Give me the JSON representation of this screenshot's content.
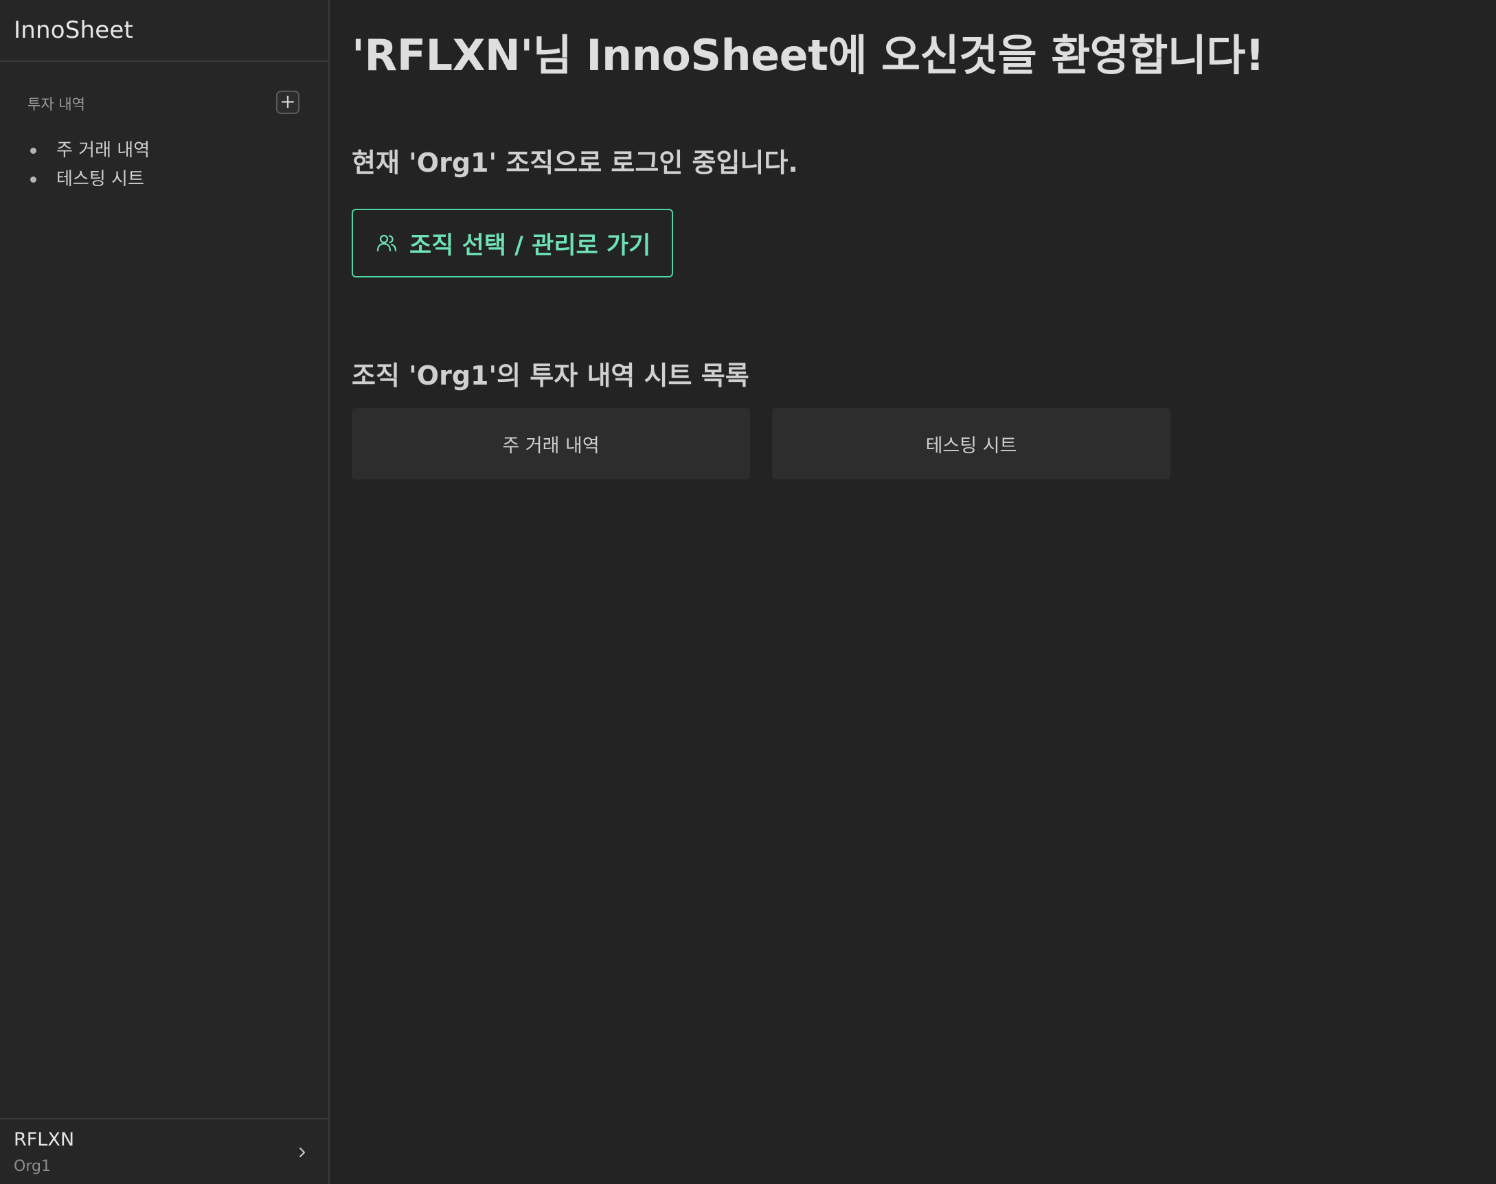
{
  "app": {
    "title": "InnoSheet"
  },
  "sidebar": {
    "section_label": "투자 내역",
    "add_button_label": "+",
    "items": [
      {
        "label": "주 거래 내역"
      },
      {
        "label": "테스팅 시트"
      }
    ],
    "footer": {
      "user_name": "RFLXN",
      "org_name": "Org1"
    }
  },
  "main": {
    "welcome": "'RFLXN'님 InnoSheet에 오신것을 환영합니다!",
    "login_status": "현재 'Org1' 조직으로 로그인 중입니다.",
    "org_button_label": "조직 선택 / 관리로 가기",
    "list_title": "조직 'Org1'의 투자 내역 시트 목록",
    "cards": [
      {
        "label": "주 거래 내역"
      },
      {
        "label": "테스팅 시트"
      }
    ]
  },
  "colors": {
    "background": "#232323",
    "sidebar": "#262626",
    "accent": "#4ed6a0",
    "card": "#2d2d2d"
  },
  "icons": {
    "org_button": "users-icon",
    "footer": "chevron-right-icon",
    "add": "plus-icon"
  }
}
